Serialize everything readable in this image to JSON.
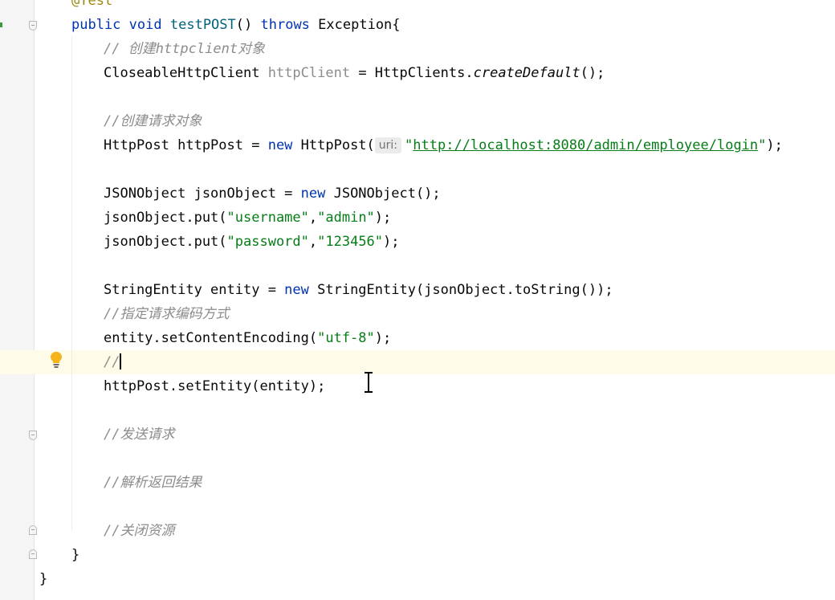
{
  "editor": {
    "annotation": "@Test",
    "method_decl": {
      "kw_public": "public",
      "kw_void": "void",
      "name": "testPOST",
      "paren": "()",
      "kw_throws": "throws",
      "rest": "Exception{"
    },
    "comment_create_client": "// 创建httpclient对象",
    "client_line": {
      "type": "CloseableHttpClient",
      "var": "httpClient",
      "eq": " = HttpClients.",
      "call": "createDefault",
      "end": "();"
    },
    "comment_create_request": "//创建请求对象",
    "post_line": {
      "start": "HttpPost httpPost = ",
      "kw_new": "new",
      "ctor": " HttpPost(",
      "hint": "uri:",
      "q1": "\"",
      "url": "http://localhost:8080/admin/employee/login",
      "q2": "\"",
      "end": ");"
    },
    "json_line": {
      "start": "JSONObject jsonObject = ",
      "kw_new": "new",
      "end": " JSONObject();"
    },
    "put_username": {
      "start": "jsonObject.put(",
      "key": "\"username\"",
      "comma": ",",
      "val": "\"admin\"",
      "end": ");"
    },
    "put_password": {
      "start": "jsonObject.put(",
      "key": "\"password\"",
      "comma": ",",
      "val": "\"123456\"",
      "end": ");"
    },
    "entity_line": {
      "start": "StringEntity entity = ",
      "kw_new": "new",
      "end": " StringEntity(jsonObject.toString());"
    },
    "comment_encoding": "//指定请求编码方式",
    "encoding_line": {
      "start": "entity.setContentEncoding(",
      "val": "\"utf-8\"",
      "end": ");"
    },
    "current_line": "//",
    "set_entity_line": "httpPost.setEntity(entity);",
    "comment_send": "//发送请求",
    "comment_parse": "//解析返回结果",
    "comment_close": "//关闭资源",
    "close_method": "}",
    "close_class": "}"
  },
  "colors": {
    "keyword": "#0033b3",
    "string": "#067d17",
    "comment": "#8c8c8c",
    "current_line": "#fffbe9",
    "bulb": "#f5b419"
  },
  "icons": [
    "lightbulb-icon",
    "text-cursor-icon",
    "fold-marker-icon"
  ]
}
